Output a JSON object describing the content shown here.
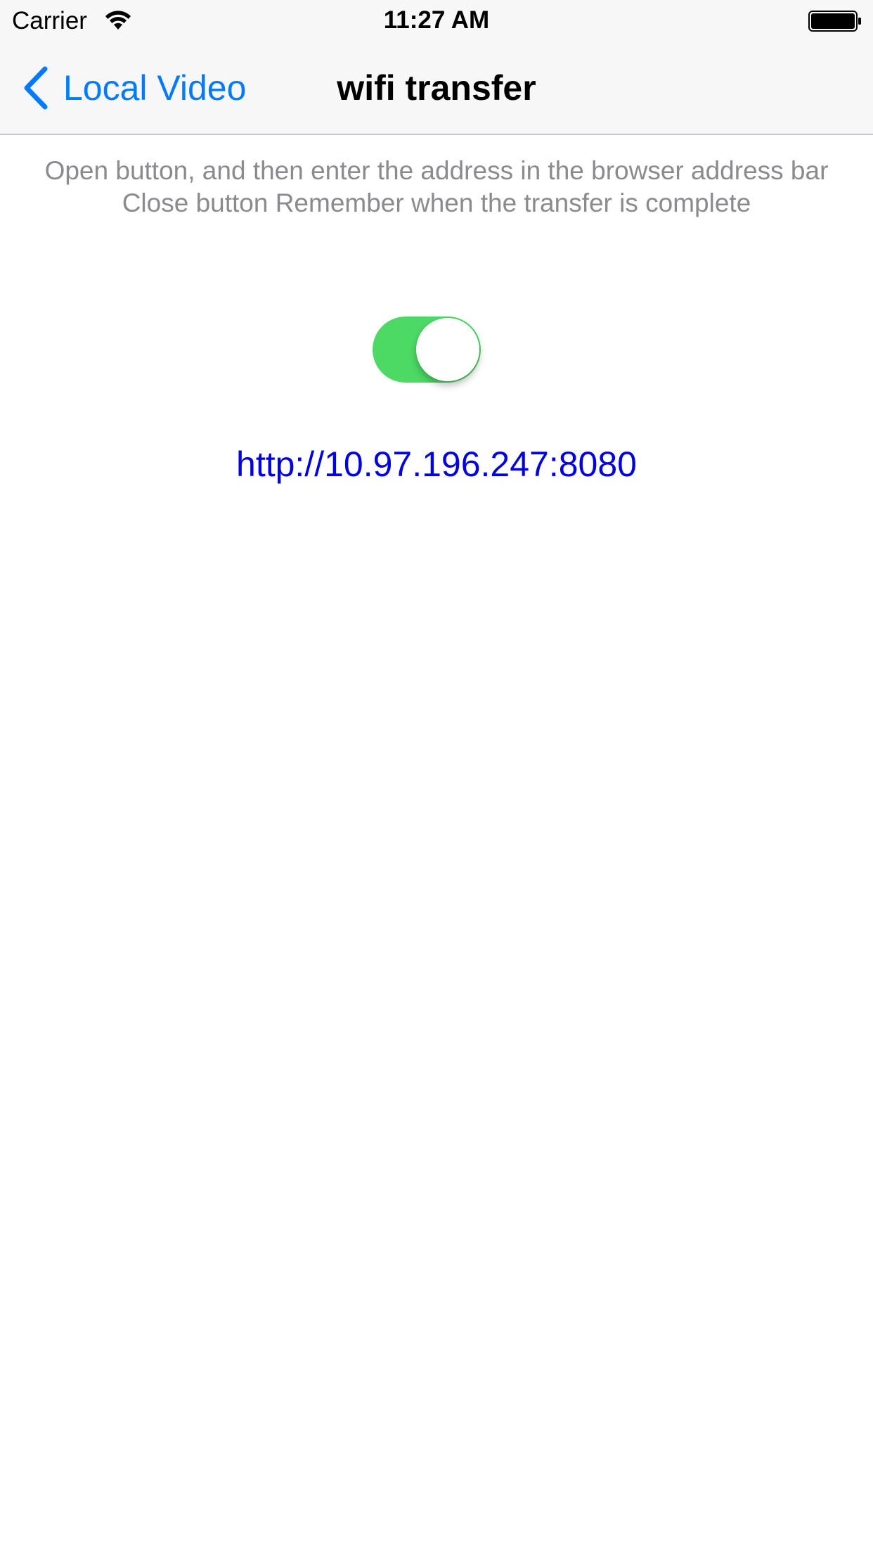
{
  "status_bar": {
    "carrier": "Carrier",
    "time": "11:27 AM",
    "wifi_icon": "wifi-icon",
    "battery_icon": "battery-full-icon"
  },
  "nav_bar": {
    "back_label": "Local Video",
    "back_icon": "chevron-left-icon",
    "title": "wifi transfer"
  },
  "main": {
    "instruction_line_1": "Open button, and then enter the address in the browser address bar",
    "instruction_line_2": "Close button Remember when the transfer is complete",
    "toggle_on": true,
    "server_url": "http://10.97.196.247:8080"
  },
  "colors": {
    "accent": "#007aff",
    "toggle_on": "#4cd964",
    "link": "#0000e6",
    "instruction_text": "#8a8a8f",
    "bar_background": "#f7f7f7"
  }
}
